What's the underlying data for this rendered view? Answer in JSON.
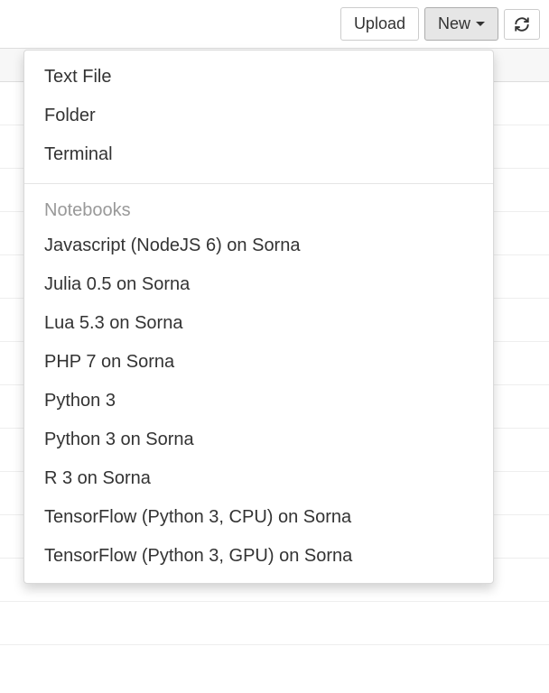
{
  "toolbar": {
    "upload_label": "Upload",
    "new_label": "New"
  },
  "dropdown": {
    "file_items": [
      "Text File",
      "Folder",
      "Terminal"
    ],
    "notebooks_header": "Notebooks",
    "notebook_items": [
      "Javascript (NodeJS 6) on Sorna",
      "Julia 0.5 on Sorna",
      "Lua 5.3 on Sorna",
      "PHP 7 on Sorna",
      "Python 3",
      "Python 3 on Sorna",
      "R 3 on Sorna",
      "TensorFlow (Python 3, CPU) on Sorna",
      "TensorFlow (Python 3, GPU) on Sorna"
    ]
  }
}
